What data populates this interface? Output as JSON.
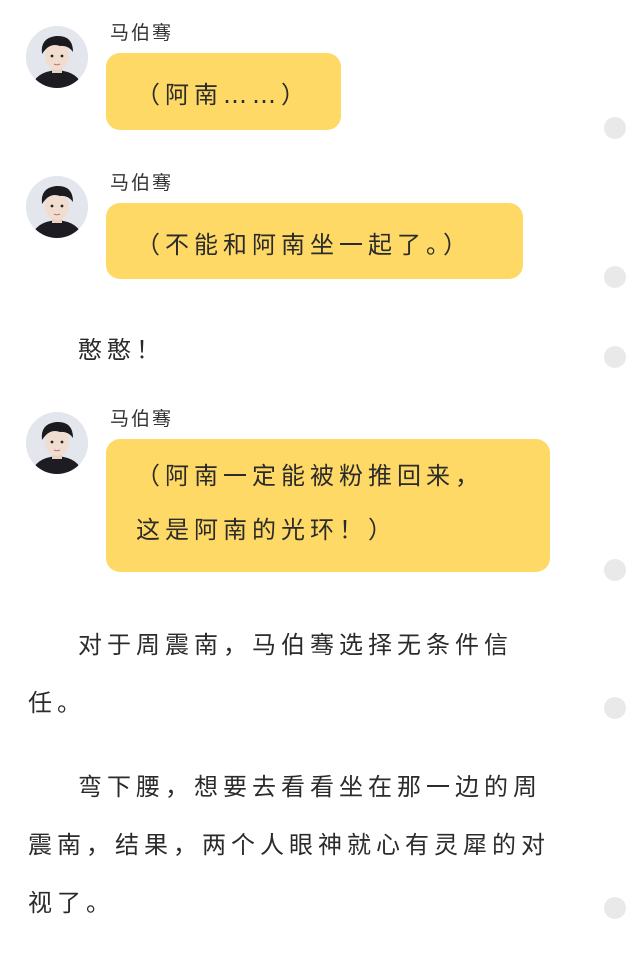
{
  "messages": [
    {
      "sender": "马伯骞",
      "avatar_icon": "avatar-boy-icon",
      "lines": [
        "（阿南……）"
      ]
    },
    {
      "sender": "马伯骞",
      "avatar_icon": "avatar-boy-icon",
      "lines": [
        "（不能和阿南坐一起了。）"
      ]
    },
    {
      "sender": "马伯骞",
      "avatar_icon": "avatar-boy-icon",
      "lines": [
        "（阿南一定能被粉推回来，",
        "这是阿南的光环！）"
      ]
    }
  ],
  "narration": {
    "line1": "憨憨！",
    "para2_line1": "对于周震南，马伯骞选择无条件信",
    "para2_line2": "任。",
    "para3_line1": "弯下腰，想要去看看坐在那一边的周",
    "para3_line2": "震南，结果，两个人眼神就心有灵犀的对",
    "para3_line3": "视了。"
  },
  "colors": {
    "bubble": "#ffd966",
    "background": "#ffffff",
    "dot": "#e9e9e9",
    "text": "#2b2b2b"
  }
}
